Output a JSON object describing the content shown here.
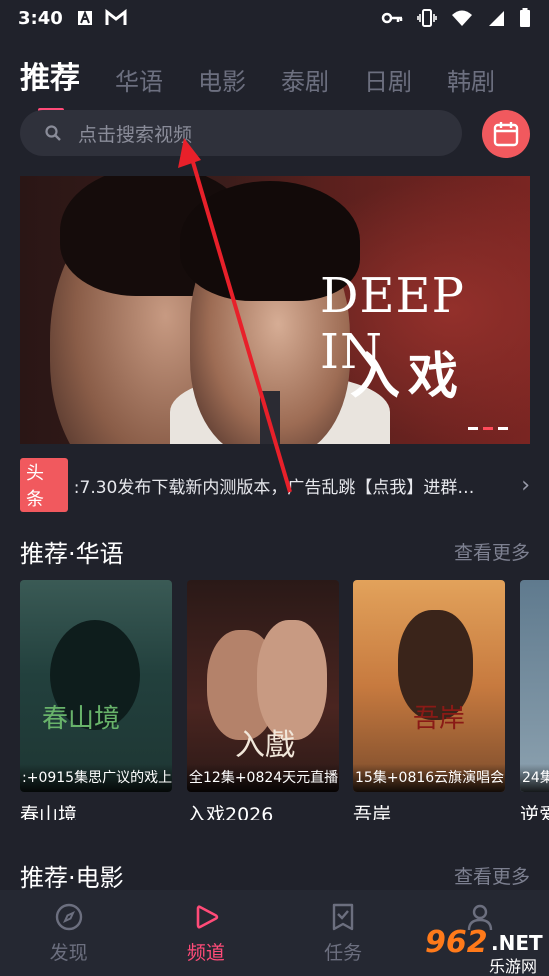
{
  "status_bar": {
    "time": "3:40"
  },
  "tabs": [
    "推荐",
    "华语",
    "电影",
    "泰剧",
    "日剧",
    "韩剧"
  ],
  "search": {
    "placeholder": "点击搜索视频"
  },
  "banner": {
    "title_en": "DEEP IN",
    "title_zh": "入戏"
  },
  "news": {
    "tag": "头条",
    "text": ":7.30发布下载新内测版本，广告乱跳【点我】进群…"
  },
  "section1": {
    "title": "推荐·华语",
    "more": "查看更多",
    "cards": [
      {
        "caption": ":+0915集思广议的戏上",
        "name": "春山境",
        "poster_title": "春山境"
      },
      {
        "caption": "全12集+0824天元直播",
        "name": "入戏2026",
        "poster_title": "入戲"
      },
      {
        "caption": "15集+0816云旗演唱会",
        "name": "吾岸",
        "poster_title": "吾岸"
      },
      {
        "caption": "24集",
        "name": "逆爱"
      }
    ]
  },
  "section2": {
    "title": "推荐·电影",
    "more": "查看更多"
  },
  "bottom_nav": [
    {
      "label": "发现",
      "icon": "compass-icon"
    },
    {
      "label": "频道",
      "icon": "play-icon",
      "active": true
    },
    {
      "label": "任务",
      "icon": "task-icon"
    },
    {
      "label": "",
      "icon": "user-icon"
    }
  ],
  "watermark": {
    "number": "962",
    "net": ".NET",
    "sub": "乐游网"
  },
  "colors": {
    "accent": "#ff4b78",
    "calendar": "#f1595e",
    "background": "#20222b"
  }
}
